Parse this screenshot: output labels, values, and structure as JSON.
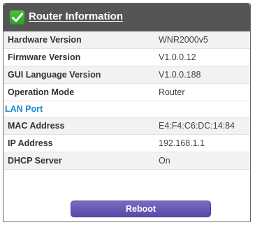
{
  "header": {
    "title": "Router Information",
    "icon": "check-icon",
    "background": "#555555",
    "icon_color": "#3db62d"
  },
  "rows": [
    {
      "label": "Hardware Version",
      "value": "WNR2000v5"
    },
    {
      "label": "Firmware Version",
      "value": "V1.0.0.12"
    },
    {
      "label": "GUI Language Version",
      "value": "V1.0.0.188"
    },
    {
      "label": "Operation Mode",
      "value": "Router"
    }
  ],
  "lan": {
    "section_label": "LAN Port",
    "section_color": "#1a8bd0",
    "rows": [
      {
        "label": "MAC Address",
        "value": "E4:F4:C6:DC:14:84"
      },
      {
        "label": "IP Address",
        "value": "192.168.1.1"
      },
      {
        "label": "DHCP Server",
        "value": "On"
      }
    ]
  },
  "reboot_button": {
    "label": "Reboot",
    "color": "#6a5bb8"
  }
}
